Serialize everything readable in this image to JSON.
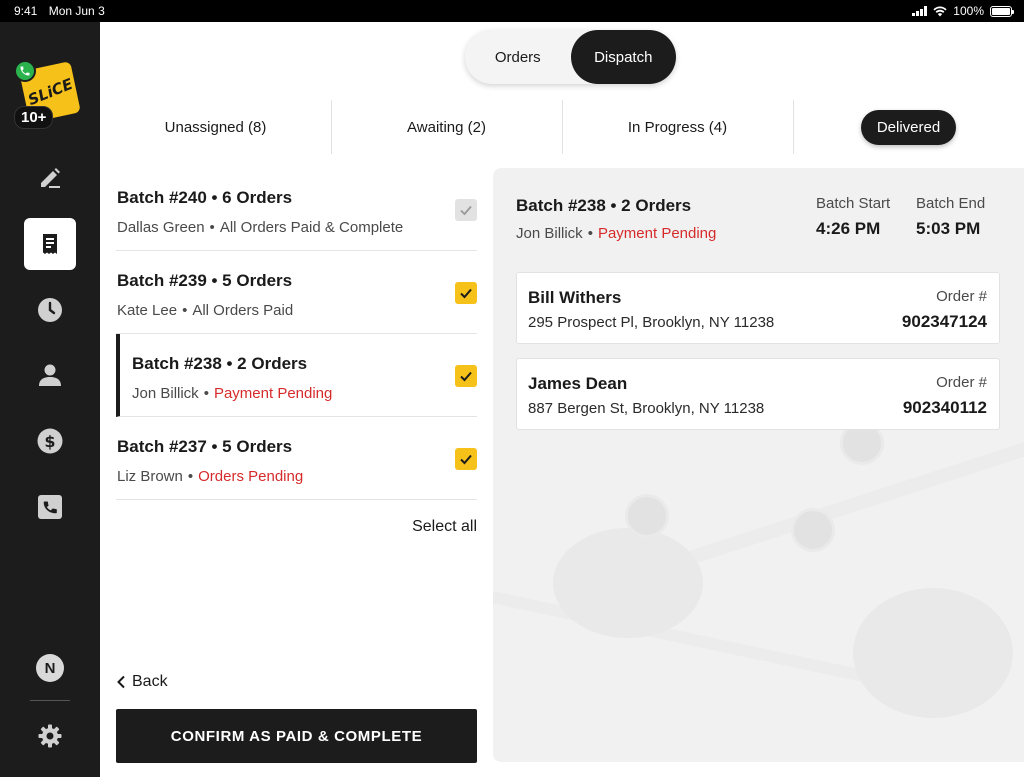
{
  "status_bar": {
    "time": "9:41",
    "date": "Mon Jun 3",
    "battery": "100%"
  },
  "sidebar": {
    "logo_text": "SLiCE",
    "notification_count": "10+",
    "avatar_initial": "N",
    "items": [
      {
        "icon": "pencil-icon"
      },
      {
        "icon": "receipt-icon",
        "active": true
      },
      {
        "icon": "clock-icon"
      },
      {
        "icon": "person-icon"
      },
      {
        "icon": "dollar-icon"
      },
      {
        "icon": "phone-icon"
      }
    ]
  },
  "segment": {
    "orders": "Orders",
    "dispatch": "Dispatch"
  },
  "tabs": {
    "unassigned": "Unassigned (8)",
    "awaiting": "Awaiting (2)",
    "in_progress": "In Progress (4)",
    "delivered": "Delivered"
  },
  "batches": [
    {
      "title": "Batch #240 • 6 Orders",
      "driver": "Dallas Green",
      "status": "All Orders Paid & Complete",
      "status_red": false
    },
    {
      "title": "Batch #239 • 5 Orders",
      "driver": "Kate Lee",
      "status": "All Orders Paid",
      "status_red": false
    },
    {
      "title": "Batch #238 • 2 Orders",
      "driver": "Jon Billick",
      "status": "Payment Pending",
      "status_red": true
    },
    {
      "title": "Batch #237 • 5 Orders",
      "driver": "Liz Brown",
      "status": "Orders Pending",
      "status_red": true
    }
  ],
  "select_all": "Select all",
  "back": "Back",
  "confirm": "CONFIRM AS PAID & COMPLETE",
  "detail": {
    "title": "Batch #238 • 2 Orders",
    "driver": "Jon Billick",
    "status": "Payment Pending",
    "start_label": "Batch Start",
    "start_time": "4:26 PM",
    "end_label": "Batch End",
    "end_time": "5:03 PM",
    "order_label": "Order #",
    "orders": [
      {
        "name": "Bill Withers",
        "address": "295 Prospect Pl, Brooklyn, NY 11238",
        "number": "902347124"
      },
      {
        "name": "James Dean",
        "address": "887 Bergen St, Brooklyn, NY 11238",
        "number": "902340112"
      }
    ]
  },
  "colors": {
    "accent": "#f6c118",
    "dark": "#1c1c1c",
    "alert": "#d62b2b"
  }
}
